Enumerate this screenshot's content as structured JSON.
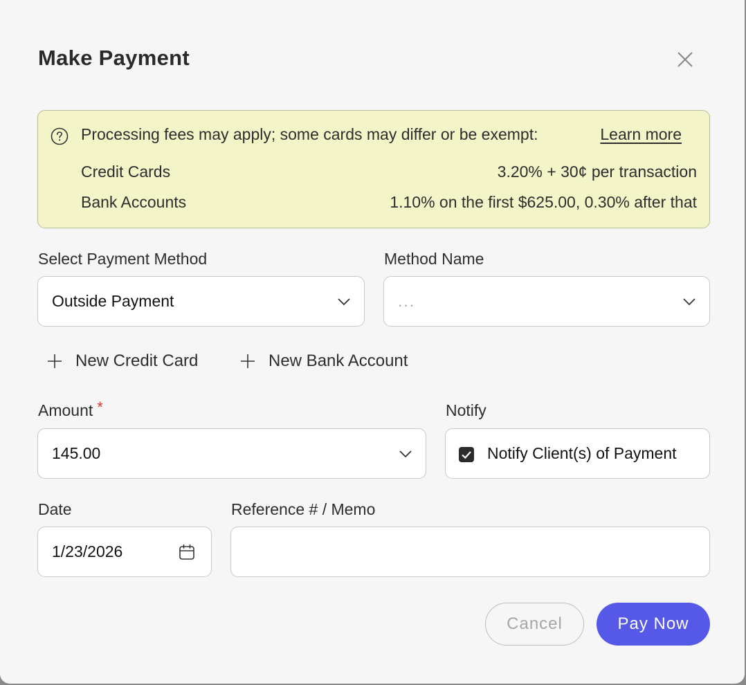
{
  "modal": {
    "title": "Make Payment"
  },
  "notice": {
    "message": "Processing fees may apply; some cards may differ or be exempt:",
    "learn_more": "Learn more",
    "fees": [
      {
        "name": "Credit Cards",
        "rate": "3.20% + 30¢ per transaction"
      },
      {
        "name": "Bank Accounts",
        "rate": "1.10% on the first $625.00, 0.30% after that"
      }
    ]
  },
  "payment_method": {
    "label": "Select Payment Method",
    "value": "Outside Payment"
  },
  "method_name": {
    "label": "Method Name",
    "placeholder": "..."
  },
  "actions": {
    "new_credit_card": "New Credit Card",
    "new_bank_account": "New Bank Account"
  },
  "amount": {
    "label": "Amount",
    "required_mark": "*",
    "value": "145.00"
  },
  "notify": {
    "label": "Notify",
    "checkbox_label": "Notify Client(s) of Payment",
    "checked": true
  },
  "date": {
    "label": "Date",
    "value": "1/23/2026"
  },
  "memo": {
    "label": "Reference # / Memo",
    "value": ""
  },
  "footer": {
    "cancel": "Cancel",
    "pay_now": "Pay Now"
  },
  "colors": {
    "accent": "#5659e8",
    "notice_bg": "#f3f4c8",
    "required": "#d93a2b"
  }
}
